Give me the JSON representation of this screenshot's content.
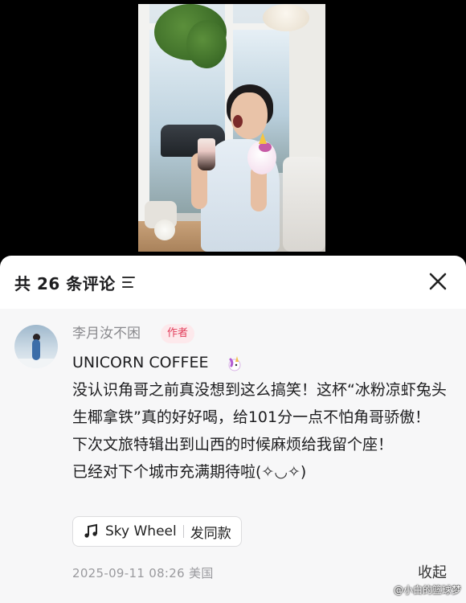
{
  "header": {
    "comment_count_title": "共 26 条评论",
    "sort_icon": "sort-lines-icon",
    "close_icon": "close-icon"
  },
  "comment": {
    "username": "李月汝不困",
    "author_badge": "作者",
    "text": "UNICORN COFFEE\n没认识角哥之前真没想到这么搞笑！这杯“冰粉凉虾兔头生椰拿铁”真的好好喝，给101分一点不怕角哥骄傲！\n下次文旅特辑出到山西的时候麻烦给我留个座！\n已经对下个城市充满期待啦(✧◡✧)",
    "emoji": "unicorn-emoji",
    "music": {
      "icon": "music-note-icon",
      "song": "Sky Wheel",
      "action": "发同款"
    },
    "timestamp": "2025-09-11 08:26",
    "location": "美国",
    "collapse_label": "收起"
  },
  "watermark": "@小白的篮球梦",
  "colors": {
    "badge_bg": "#fde9ec",
    "badge_text": "#e23d5a",
    "sheet_bg": "#f7f7f8"
  }
}
